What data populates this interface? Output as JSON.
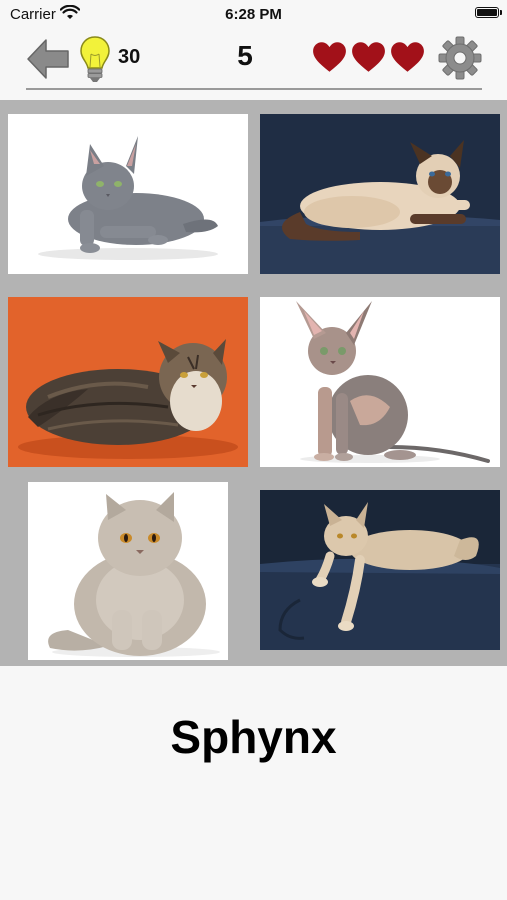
{
  "status": {
    "carrier": "Carrier",
    "time": "6:28 PM"
  },
  "toolbar": {
    "hint_count": "30",
    "score": "5",
    "lives": 3,
    "colors": {
      "heart": "#a01018",
      "arrow": "#888888",
      "bulb": "#e6e600",
      "gear": "#8c8c8c"
    }
  },
  "grid": {
    "cells": [
      {
        "name": "cat-photo-grey-cat-lying",
        "bg": "#ffffff"
      },
      {
        "name": "cat-photo-siamese-lying",
        "bg": "#22324a"
      },
      {
        "name": "cat-photo-long-haired-tabby-orange-bg",
        "bg": "#e2632b"
      },
      {
        "name": "cat-photo-hairless-cat-sitting",
        "bg": "#ffffff"
      },
      {
        "name": "cat-photo-fluffy-cream-cat-sitting",
        "bg": "#ffffff"
      },
      {
        "name": "cat-photo-cream-long-haired-cat-lying",
        "bg": "#1d2b40"
      }
    ]
  },
  "answer": "Sphynx"
}
